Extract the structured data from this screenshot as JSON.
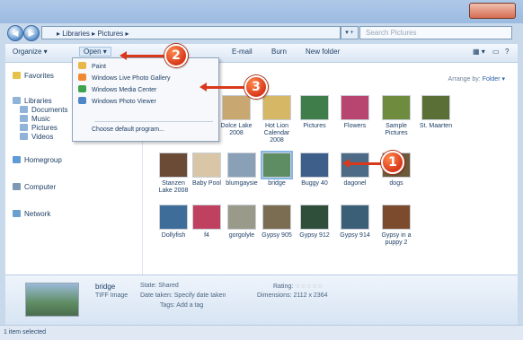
{
  "address": {
    "path": "▸ Libraries ▸ Pictures ▸",
    "search_placeholder": "Search Pictures",
    "dropdown": "▾ +"
  },
  "toolbar": {
    "organize": "Organize ▾",
    "open": "Open ▾",
    "email": "E-mail",
    "burn": "Burn",
    "new_folder": "New folder"
  },
  "nav": {
    "favorites": "Favorites",
    "libraries": "Libraries",
    "documents": "Documents",
    "music": "Music",
    "pictures": "Pictures",
    "videos": "Videos",
    "homegroup": "Homegroup",
    "computer": "Computer",
    "network": "Network"
  },
  "content": {
    "arrange_label": "Arrange by:",
    "arrange_value": "Folder ▾"
  },
  "menu": {
    "items": [
      "Paint",
      "Windows Live Photo Gallery",
      "Windows Media Center",
      "Windows Photo Viewer"
    ],
    "default_program": "Choose default program..."
  },
  "thumbs": [
    {
      "label": "Dolce Lake 2008",
      "color": "#c8a870"
    },
    {
      "label": "Hot Lion Calendar 2008",
      "color": "#d6b765"
    },
    {
      "label": "Pictures",
      "color": "#3f7d4a"
    },
    {
      "label": "Flowers",
      "color": "#b84570"
    },
    {
      "label": "Sample Pictures",
      "color": "#6f8c3e"
    },
    {
      "label": "St. Maarten",
      "color": "#5a6f35"
    },
    {
      "label": "Stanzen Lake 2008",
      "color": "#6b4b36"
    },
    {
      "label": "Baby Pool",
      "color": "#d8c6a6"
    },
    {
      "label": "blumgaysie",
      "color": "#8aa0b6"
    },
    {
      "label": "bridge",
      "color": "#5f8d63"
    },
    {
      "label": "Buggy 40",
      "color": "#3e5f8a"
    },
    {
      "label": "dagonel",
      "color": "#4d6b87"
    },
    {
      "label": "dogs",
      "color": "#6d5a3a"
    },
    {
      "label": "Dollyfish",
      "color": "#3d6d98"
    },
    {
      "label": "f4",
      "color": "#c04060"
    },
    {
      "label": "gorgolyle",
      "color": "#9a9a8a"
    },
    {
      "label": "Gypsy 905",
      "color": "#7a6d52"
    },
    {
      "label": "Gypsy 912",
      "color": "#2f4f3a"
    },
    {
      "label": "Gypsy 914",
      "color": "#3c5f78"
    },
    {
      "label": "Gypsy in a puppy 2",
      "color": "#7c4a2c"
    }
  ],
  "details": {
    "name": "bridge",
    "type": "TIFF Image",
    "state_label": "State:",
    "state_value": "Shared",
    "date_label": "Date taken:",
    "date_value": "Specify date taken",
    "tags_label": "Tags:",
    "tags_value": "Add a tag",
    "rating_label": "Rating:",
    "rating_value": "☆☆☆☆☆",
    "dimensions_label": "Dimensions:",
    "dimensions_value": "2112 x 2364"
  },
  "status": {
    "text": "1 item selected"
  },
  "callouts": [
    "1",
    "2",
    "3"
  ],
  "colors": {
    "callout": "#d9381b",
    "accent": "#2a5fa8"
  }
}
